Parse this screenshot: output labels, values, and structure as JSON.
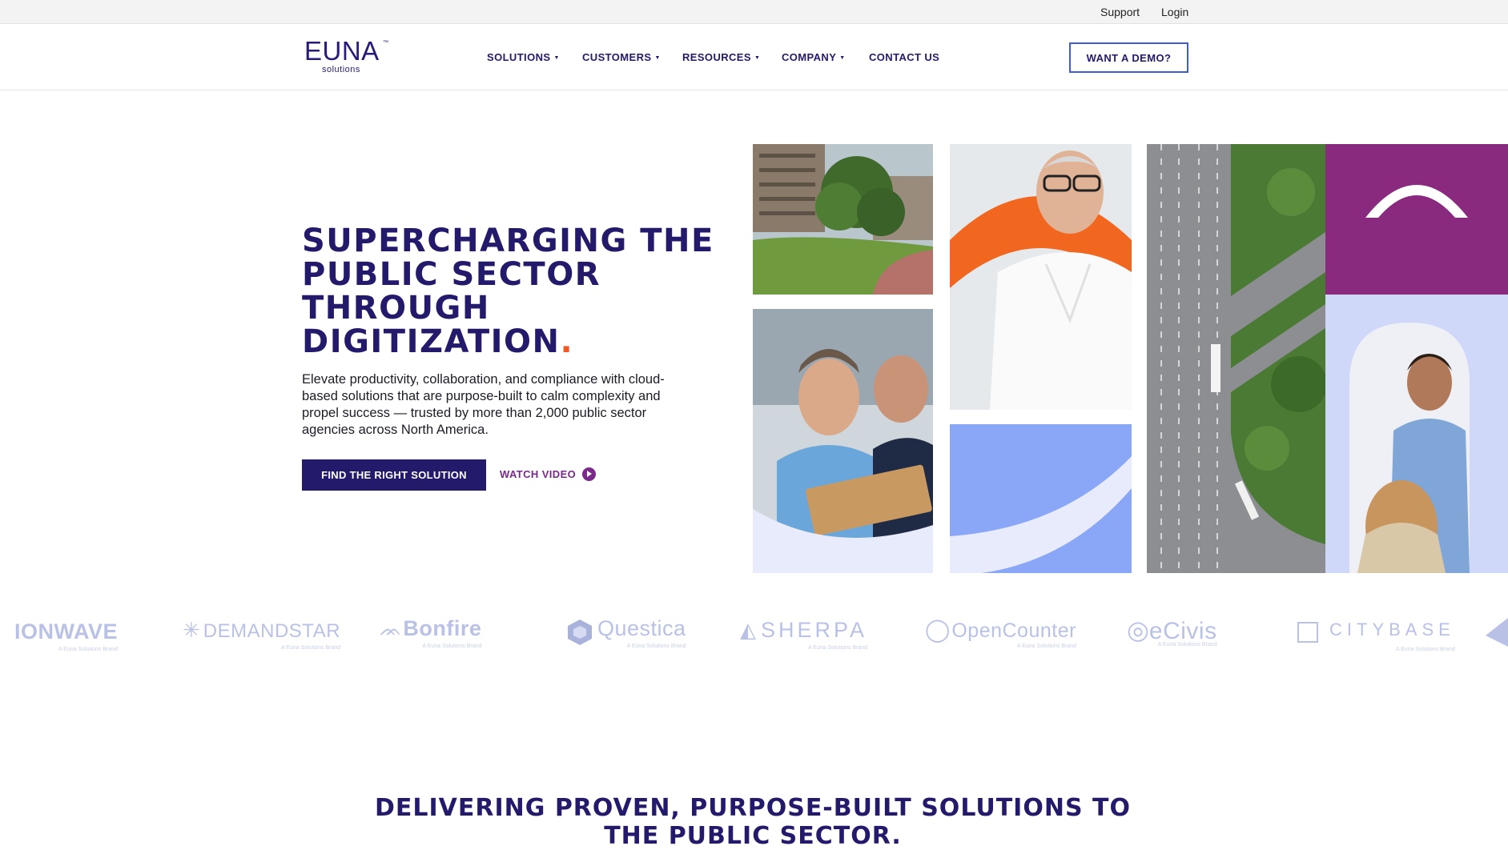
{
  "utility": {
    "support": "Support",
    "login": "Login"
  },
  "logo": {
    "word": "EUNA",
    "sub": "solutions",
    "tm": "™"
  },
  "nav": {
    "items": [
      {
        "label": "SOLUTIONS",
        "caret": "▼"
      },
      {
        "label": "CUSTOMERS",
        "caret": "▼"
      },
      {
        "label": "RESOURCES",
        "caret": "▼"
      },
      {
        "label": "COMPANY",
        "caret": "▼"
      },
      {
        "label": "CONTACT US",
        "caret": ""
      }
    ],
    "demo_label": "WANT A DEMO?"
  },
  "hero": {
    "title": "SUPERCHARGING THE PUBLIC SECTOR THROUGH DIGITIZATION",
    "title_dot": ".",
    "body": "Elevate productivity, collaboration, and compliance with cloud-based solutions that are purpose-built to calm complexity and propel success — trusted by more than 2,000 public sector agencies across North America.",
    "cta_primary": "FIND THE RIGHT SOLUTION",
    "cta_video": "WATCH VIDEO"
  },
  "brands": [
    {
      "name": "IONWAVE",
      "tag": "A Euna Solutions Brand"
    },
    {
      "name": "DEMANDSTAR",
      "tag": "A Euna Solutions Brand"
    },
    {
      "name": "Bonfire",
      "tag": "A Euna Solutions Brand"
    },
    {
      "name": "Questica",
      "tag": "A Euna Solutions Brand"
    },
    {
      "name": "SHERPA",
      "tag": "A Euna Solutions Brand"
    },
    {
      "name": "OpenCounter",
      "tag": "A Euna Solutions Brand"
    },
    {
      "name": "eCivis",
      "tag": "A Euna Solutions Brand"
    },
    {
      "name": "CITYBASE",
      "tag": "A Euna Solutions Brand"
    }
  ],
  "section": {
    "title": "DELIVERING PROVEN, PURPOSE-BUILT SOLUTIONS TO THE PUBLIC SECTOR."
  },
  "colors": {
    "brand_navy": "#241a6b",
    "accent_orange": "#f05a22",
    "accent_purple": "#8a2a7e",
    "accent_blue": "#8aa6f7",
    "pale_lavender": "#e8ebfb"
  }
}
